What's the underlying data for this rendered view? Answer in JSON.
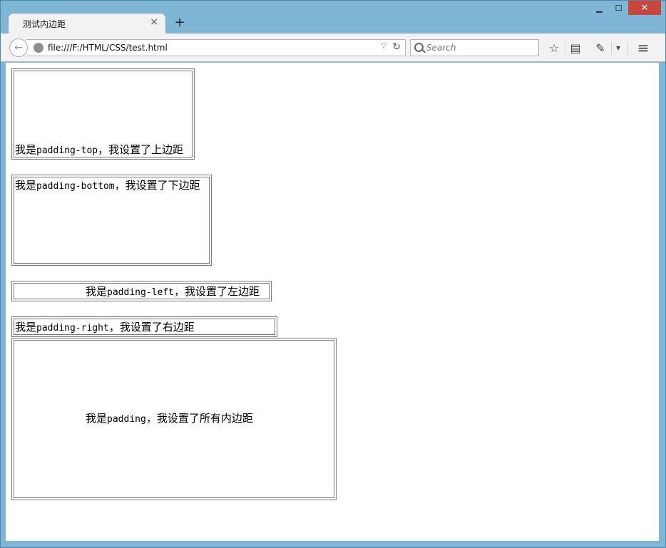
{
  "window": {
    "tab_title": "测试内边距",
    "tab_close": "×",
    "new_tab": "+",
    "minimize": "▁",
    "maximize": "☐",
    "close": "✕"
  },
  "navbar": {
    "back": "←",
    "url": "file:///F:/HTML/CSS/test.html",
    "url_dropdown": "▽",
    "reload": "↻",
    "search_placeholder": "Search",
    "bookmark_star": "☆",
    "reading_list": "▤",
    "addon_icon": "✎",
    "addon_dropdown": "▾",
    "menu": "≡"
  },
  "boxes": {
    "top": {
      "pre": "我是",
      "mono": "padding-top",
      "post": "，我设置了上边距"
    },
    "bottom": {
      "pre": "我是",
      "mono": "padding-bottom",
      "post": "，我设置了下边距"
    },
    "left": {
      "pre": "我是",
      "mono": "padding-left",
      "post": "，我设置了左边距"
    },
    "right": {
      "pre": "我是",
      "mono": "padding-right",
      "post": "，我设置了右边距"
    },
    "all": {
      "pre": "我是",
      "mono": "padding",
      "post": "，我设置了所有内边距"
    }
  }
}
